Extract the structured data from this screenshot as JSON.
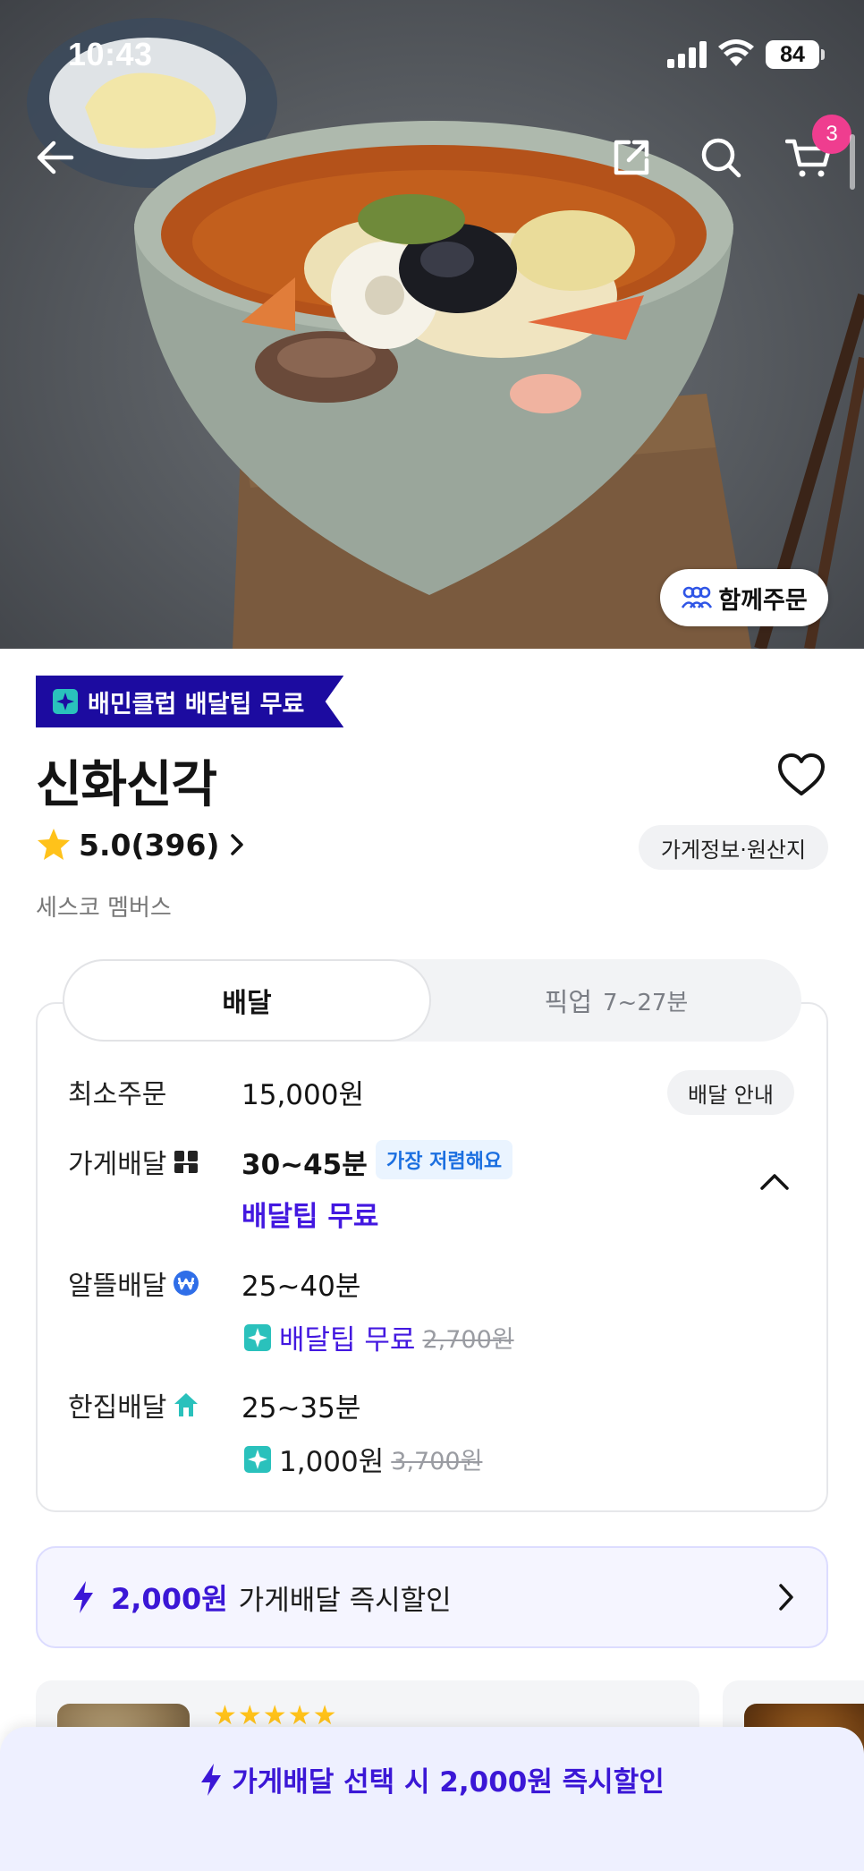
{
  "status_bar": {
    "time": "10:43",
    "battery": "84"
  },
  "nav": {
    "cart_count": "3"
  },
  "hero": {
    "group_order_label": "함께주문"
  },
  "store": {
    "club_badge": "배민클럽 배달팁 무료",
    "name": "신화신각",
    "rating": "5.0(396)",
    "info_chip": "가게정보·원산지",
    "membership": "세스코 멤버스"
  },
  "tabs": {
    "delivery": "배달",
    "pickup": "픽업",
    "pickup_time": "7~27분"
  },
  "delivery": {
    "min_order_label": "최소주문",
    "min_order_value": "15,000원",
    "guide_chip": "배달 안내",
    "store_delivery": {
      "label": "가게배달",
      "time": "30~45분",
      "tag": "가장 저렴해요",
      "tip": "배달팁 무료"
    },
    "saver_delivery": {
      "label": "알뜰배달",
      "time": "25~40분",
      "tip": "배달팁 무료",
      "original": "2,700원"
    },
    "single_delivery": {
      "label": "한집배달",
      "time": "25~35분",
      "tip": "1,000원",
      "original": "3,700원"
    }
  },
  "discount_banner": {
    "amount": "2,000원",
    "text": "가게배달 즉시할인"
  },
  "reviews": {
    "stars": "★★★★★"
  },
  "bottom_cta": {
    "text": "가게배달 선택 시 2,000원 즉시할인"
  },
  "colors": {
    "accent": "#3b17d6",
    "club": "#1c0ba0",
    "badge": "#ef3d8f",
    "mint": "#2ac1bc"
  }
}
